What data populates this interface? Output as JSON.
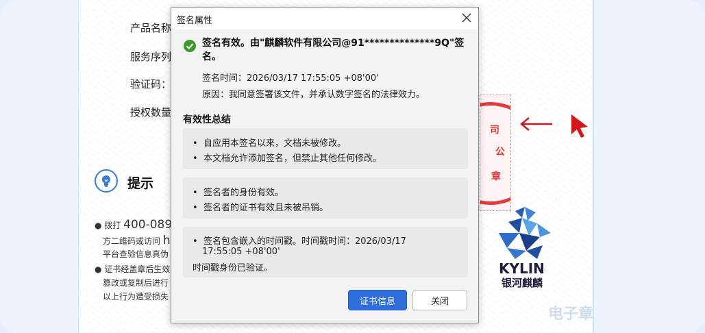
{
  "document": {
    "fields": [
      "产品名称",
      "服务序列",
      "验证码：",
      "授权数量"
    ],
    "tip_title": "提示",
    "tip_lines": [
      {
        "bullet": "●",
        "text": "拨打 ",
        "big": "400-089"
      },
      {
        "bullet": "",
        "text": "方二维码或访问 ",
        "big": "h"
      },
      {
        "bullet": "",
        "text": "平台查验信息真伪",
        "big": ""
      },
      {
        "bullet": "●",
        "text": "证书经盖章后生效",
        "big": ""
      },
      {
        "bullet": "",
        "text": "篡改或复制后进行",
        "big": ""
      },
      {
        "bullet": "",
        "text": "以上行为遭受损失",
        "big": ""
      }
    ],
    "stamp_chars": [
      "司",
      "公",
      "章"
    ],
    "brand_word": "KYLIN",
    "brand_cn": "银河麒麟",
    "watermark": "电子章"
  },
  "dialog": {
    "title": "签名属性",
    "status": "签名有效。由\"麒麟软件有限公司@91**************9Q\"签名。",
    "sign_time": "签名时间：2026/03/17 17:55:05 +08'00'",
    "reason": "原因：我同意签署该文件，并承认数字签名的法律效力。",
    "section_title": "有效性总结",
    "panels": [
      [
        "自应用本签名以来，文档未被修改。",
        "本文档允许添加签名，但禁止其他任何修改。"
      ],
      [
        "签名者的身份有效。",
        "签名者的证书有效且未被吊销。"
      ]
    ],
    "timestamp_line1": "签名包含嵌入的时间戳。时间戳时间：2026/03/17",
    "timestamp_line2": "17:55:05 +08'00'",
    "timestamp_verified": "时间戳身份已验证。",
    "bullet_char": "•",
    "btn_cert": "证书信息",
    "btn_close": "关闭"
  },
  "colors": {
    "primary": "#2f6fdd",
    "success": "#3a9a2c",
    "stamp_red": "#e23a3a",
    "arrow_red": "#c8191e"
  }
}
